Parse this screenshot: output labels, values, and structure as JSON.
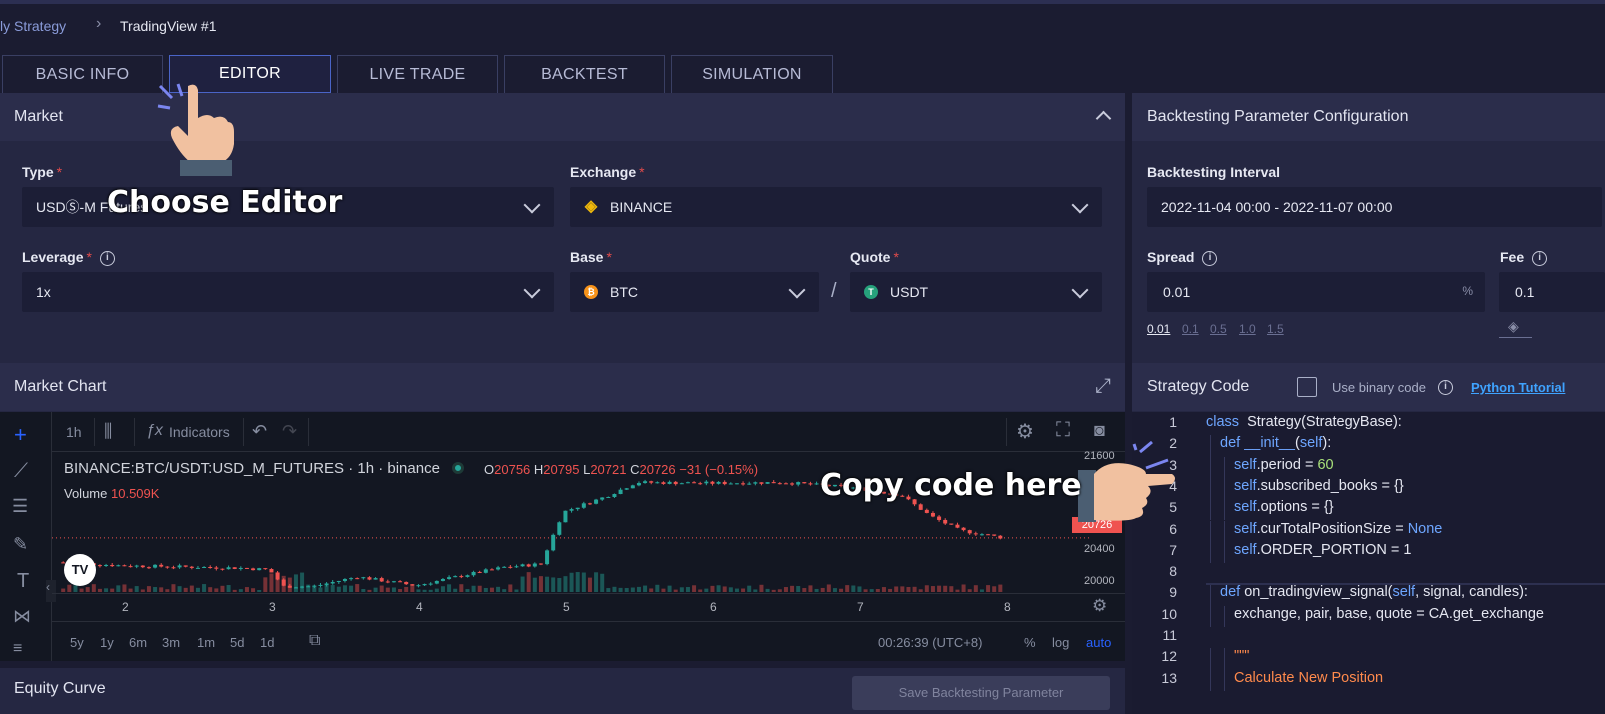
{
  "breadcrumb": {
    "parent": "ly Strategy",
    "current": "TradingView #1"
  },
  "tabs": [
    "BASIC INFO",
    "EDITOR",
    "LIVE TRADE",
    "BACKTEST",
    "SIMULATION"
  ],
  "active_tab": "EDITOR",
  "market": {
    "title": "Market",
    "type_label": "Type",
    "type_value": "USDⓈ-M Futures",
    "exchange_label": "Exchange",
    "exchange_value": "BINANCE",
    "leverage_label": "Leverage",
    "leverage_value": "1x",
    "base_label": "Base",
    "base_value": "BTC",
    "quote_label": "Quote",
    "quote_value": "USDT",
    "slash": "/"
  },
  "backtest": {
    "title": "Backtesting Parameter Configuration",
    "interval_label": "Backtesting Interval",
    "interval_value": "2022-11-04 00:00 - 2022-11-07 00:00",
    "spread_label": "Spread",
    "spread_value": "0.01",
    "spread_unit": "%",
    "spread_options": [
      "0.01",
      "0.1",
      "0.5",
      "1.0",
      "1.5"
    ],
    "fee_label": "Fee",
    "fee_value": "0.1"
  },
  "market_chart": {
    "title": "Market Chart",
    "interval": "1h",
    "indicators_label": "Indicators",
    "symbol": "BINANCE:BTC/USDT:USD_M_FUTURES · 1h · binance",
    "o_label": "O",
    "o_value": "20756",
    "h_label": "H",
    "h_value": "20795",
    "l_label": "L",
    "l_value": "20721",
    "c_label": "C",
    "c_value": "20726",
    "change": "−31 (−0.15%)",
    "volume_label": "Volume",
    "volume_value": "10.509K",
    "price_labels": [
      "21600",
      "20726",
      "20400",
      "20000"
    ],
    "x_labels": [
      "2",
      "3",
      "4",
      "5",
      "6",
      "7",
      "8"
    ],
    "ranges": [
      "5y",
      "1y",
      "6m",
      "3m",
      "1m",
      "5d",
      "1d"
    ],
    "clock": "00:26:39 (UTC+8)",
    "percent": "%",
    "log": "log",
    "auto": "auto"
  },
  "chart_data": {
    "type": "line",
    "title": "BINANCE:BTC/USDT:USD_M_FUTURES · 1h · binance",
    "xlabel": "",
    "ylabel": "",
    "x": [
      2,
      3,
      4,
      5,
      6,
      7,
      8
    ],
    "y_close_approx": [
      20380,
      20320,
      20130,
      20360,
      21400,
      21350,
      20726
    ],
    "ylim": [
      19950,
      21700
    ],
    "last_price": 20726
  },
  "strategy": {
    "title": "Strategy Code",
    "binary_label": "Use binary code",
    "tutorial_link": "Python Tutorial"
  },
  "code_lines": [
    {
      "n": "1",
      "indent": 0,
      "parts": [
        [
          "kw",
          "class"
        ],
        [
          "",
          "  Strategy(StrategyBase):"
        ]
      ]
    },
    {
      "n": "2",
      "indent": 1,
      "parts": [
        [
          "kw",
          "def"
        ],
        [
          "",
          ""
        ],
        [
          "kw",
          " __init__"
        ],
        [
          "",
          "("
        ],
        [
          "kw",
          "self"
        ],
        [
          "",
          "):"
        ]
      ]
    },
    {
      "n": "3",
      "indent": 2,
      "parts": [
        [
          "kw",
          "self"
        ],
        [
          "",
          ".period = "
        ],
        [
          "num",
          "60"
        ]
      ]
    },
    {
      "n": "4",
      "indent": 2,
      "parts": [
        [
          "kw",
          "self"
        ],
        [
          "",
          ".subscribed_books = {}"
        ]
      ]
    },
    {
      "n": "5",
      "indent": 2,
      "parts": [
        [
          "kw",
          "self"
        ],
        [
          "",
          ".options = {}"
        ]
      ]
    },
    {
      "n": "6",
      "indent": 2,
      "parts": [
        [
          "kw",
          "self"
        ],
        [
          "",
          ".curTotalPositionSize = "
        ],
        [
          "kw",
          "None"
        ]
      ]
    },
    {
      "n": "7",
      "indent": 2,
      "parts": [
        [
          "kw",
          "self"
        ],
        [
          "",
          ".ORDER_PORTION = 1"
        ]
      ]
    },
    {
      "n": "8",
      "indent": 0,
      "parts": []
    },
    {
      "n": "9",
      "indent": 1,
      "parts": [
        [
          "kw",
          "def"
        ],
        [
          "",
          " on_tradingview_signal("
        ],
        [
          "kw",
          "self"
        ],
        [
          "",
          ", signal, candles):"
        ]
      ]
    },
    {
      "n": "10",
      "indent": 2,
      "parts": [
        [
          "",
          "exchange, pair, base, quote = CA.get_exchange"
        ]
      ]
    },
    {
      "n": "11",
      "indent": 0,
      "parts": []
    },
    {
      "n": "12",
      "indent": 2,
      "parts": [
        [
          "str",
          "\"\"\""
        ]
      ]
    },
    {
      "n": "13",
      "indent": 2,
      "parts": [
        [
          "str",
          "Calculate New Position"
        ]
      ]
    }
  ],
  "equity": {
    "title": "Equity Curve",
    "save_label": "Save Backtesting Parameter"
  },
  "annotations": {
    "choose_editor": "Choose Editor",
    "copy_code": "Copy code here"
  },
  "colors": {
    "accent": "#4a64c7",
    "required": "#e24b4b",
    "up": "#26a69a",
    "down": "#ef5350"
  }
}
